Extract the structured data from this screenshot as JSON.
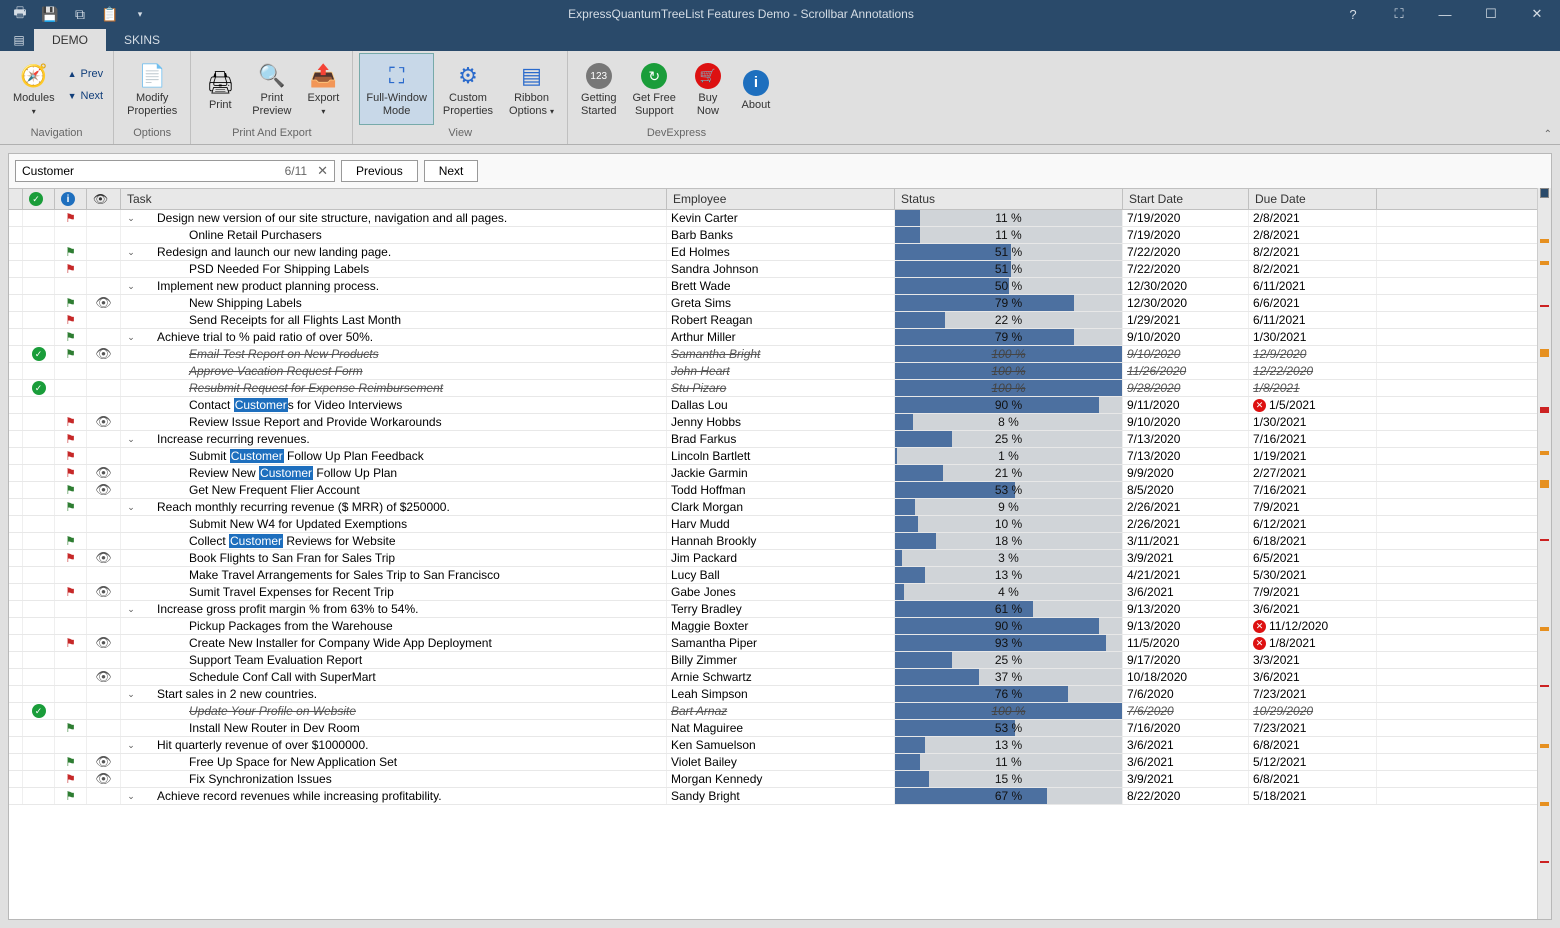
{
  "window": {
    "title": "ExpressQuantumTreeList Features Demo - Scrollbar Annotations"
  },
  "tabs": {
    "demo": "DEMO",
    "skins": "SKINS"
  },
  "ribbon": {
    "modules": "Modules",
    "navigation": "Navigation",
    "prev": "Prev",
    "next": "Next",
    "modify_props": "Modify\nProperties",
    "options": "Options",
    "print": "Print",
    "print_preview": "Print\nPreview",
    "export": "Export",
    "print_and_export": "Print And Export",
    "full_window": "Full-Window\nMode",
    "custom_props": "Custom\nProperties",
    "ribbon_opts": "Ribbon\nOptions",
    "view": "View",
    "getting_started": "Getting\nStarted",
    "get_free_support": "Get Free\nSupport",
    "buy_now": "Buy\nNow",
    "about": "About",
    "devexpress": "DevExpress"
  },
  "search": {
    "value": "Customer",
    "count": "6/11",
    "previous": "Previous",
    "next": "Next"
  },
  "columns": {
    "task": "Task",
    "employee": "Employee",
    "status": "Status",
    "start": "Start Date",
    "due": "Due Date"
  },
  "rows": [
    {
      "lvl": 1,
      "exp": true,
      "task": "Design new version of our site structure, navigation and all pages.",
      "emp": "Kevin Carter",
      "pct": 11,
      "start": "7/19/2020",
      "due": "2/8/2021",
      "flag": "red"
    },
    {
      "lvl": 2,
      "task": "Online Retail Purchasers",
      "emp": "Barb Banks",
      "pct": 11,
      "start": "7/19/2020",
      "due": "2/8/2021"
    },
    {
      "lvl": 1,
      "exp": true,
      "task": "Redesign and launch our new landing page.",
      "emp": "Ed Holmes",
      "pct": 51,
      "start": "7/22/2020",
      "due": "8/2/2021",
      "flag": "green"
    },
    {
      "lvl": 2,
      "task": "PSD Needed For Shipping Labels",
      "emp": "Sandra Johnson",
      "pct": 51,
      "start": "7/22/2020",
      "due": "8/2/2021",
      "flag": "red"
    },
    {
      "lvl": 1,
      "exp": true,
      "task": "Implement new product planning process.",
      "emp": "Brett Wade",
      "pct": 50,
      "start": "12/30/2020",
      "due": "6/11/2021"
    },
    {
      "lvl": 2,
      "task": "New Shipping Labels",
      "emp": "Greta Sims",
      "pct": 79,
      "start": "12/30/2020",
      "due": "6/6/2021",
      "flag": "green",
      "eye": true
    },
    {
      "lvl": 2,
      "task": "Send Receipts for all Flights Last Month",
      "emp": "Robert Reagan",
      "pct": 22,
      "start": "1/29/2021",
      "due": "6/11/2021",
      "flag": "red"
    },
    {
      "lvl": 1,
      "exp": true,
      "task": "Achieve trial to % paid ratio of over 50%.",
      "emp": "Arthur Miller",
      "pct": 79,
      "start": "9/10/2020",
      "due": "1/30/2021",
      "flag": "green"
    },
    {
      "lvl": 2,
      "task": "Email Test Report on New Products",
      "emp": "Samantha Bright",
      "pct": 100,
      "start": "9/10/2020",
      "due": "12/9/2020",
      "done": true,
      "struck": true,
      "flag": "green",
      "eye": true
    },
    {
      "lvl": 2,
      "task": "Approve Vacation Request Form",
      "emp": "John Heart",
      "pct": 100,
      "start": "11/26/2020",
      "due": "12/22/2020",
      "struck": true
    },
    {
      "lvl": 2,
      "task": "Resubmit Request for Expense Reimbursement",
      "emp": "Stu Pizaro",
      "pct": 100,
      "start": "9/28/2020",
      "due": "1/8/2021",
      "done": true,
      "struck": true
    },
    {
      "lvl": 2,
      "task_pre": "Contact ",
      "task_hl": "Customer",
      "task_post": "s for Video Interviews",
      "emp": "Dallas Lou",
      "pct": 90,
      "start": "9/11/2020",
      "due": "1/5/2021",
      "warn": true
    },
    {
      "lvl": 2,
      "task": "Review Issue Report and Provide Workarounds",
      "emp": "Jenny Hobbs",
      "pct": 8,
      "start": "9/10/2020",
      "due": "1/30/2021",
      "flag": "red",
      "eye": true
    },
    {
      "lvl": 1,
      "exp": true,
      "task": "Increase recurring revenues.",
      "emp": "Brad Farkus",
      "pct": 25,
      "start": "7/13/2020",
      "due": "7/16/2021",
      "flag": "red"
    },
    {
      "lvl": 2,
      "task_pre": "Submit ",
      "task_hl": "Customer",
      "task_post": " Follow Up Plan Feedback",
      "emp": "Lincoln Bartlett",
      "pct": 1,
      "start": "7/13/2020",
      "due": "1/19/2021",
      "flag": "red"
    },
    {
      "lvl": 2,
      "task_pre": "Review New ",
      "task_hl": "Customer",
      "task_post": " Follow Up Plan",
      "emp": "Jackie Garmin",
      "pct": 21,
      "start": "9/9/2020",
      "due": "2/27/2021",
      "flag": "red",
      "eye": true
    },
    {
      "lvl": 2,
      "task": "Get New Frequent Flier Account",
      "emp": "Todd Hoffman",
      "pct": 53,
      "start": "8/5/2020",
      "due": "7/16/2021",
      "flag": "green",
      "eye": true
    },
    {
      "lvl": 1,
      "exp": true,
      "task": "Reach monthly recurring revenue ($ MRR) of $250000.",
      "emp": "Clark Morgan",
      "pct": 9,
      "start": "2/26/2021",
      "due": "7/9/2021",
      "flag": "green"
    },
    {
      "lvl": 2,
      "task": "Submit New W4 for Updated Exemptions",
      "emp": "Harv Mudd",
      "pct": 10,
      "start": "2/26/2021",
      "due": "6/12/2021"
    },
    {
      "lvl": 2,
      "task_pre": "Collect ",
      "task_hl": "Customer",
      "task_post": " Reviews for Website",
      "emp": "Hannah Brookly",
      "pct": 18,
      "start": "3/11/2021",
      "due": "6/18/2021",
      "flag": "green"
    },
    {
      "lvl": 2,
      "task": "Book Flights to San Fran for Sales Trip",
      "emp": "Jim Packard",
      "pct": 3,
      "start": "3/9/2021",
      "due": "6/5/2021",
      "flag": "red",
      "eye": true
    },
    {
      "lvl": 2,
      "task": "Make Travel Arrangements for Sales Trip to San Francisco",
      "emp": "Lucy Ball",
      "pct": 13,
      "start": "4/21/2021",
      "due": "5/30/2021"
    },
    {
      "lvl": 2,
      "task": "Sumit Travel Expenses for Recent Trip",
      "emp": "Gabe Jones",
      "pct": 4,
      "start": "3/6/2021",
      "due": "7/9/2021",
      "flag": "red",
      "eye": true
    },
    {
      "lvl": 1,
      "exp": true,
      "task": "Increase gross profit margin % from 63% to 54%.",
      "emp": "Terry Bradley",
      "pct": 61,
      "start": "9/13/2020",
      "due": "3/6/2021"
    },
    {
      "lvl": 2,
      "task": "Pickup Packages from the Warehouse",
      "emp": "Maggie Boxter",
      "pct": 90,
      "start": "9/13/2020",
      "due": "11/12/2020",
      "warn": true
    },
    {
      "lvl": 2,
      "task": "Create New Installer for Company Wide App Deployment",
      "emp": "Samantha Piper",
      "pct": 93,
      "start": "11/5/2020",
      "due": "1/8/2021",
      "flag": "red",
      "eye": true,
      "warn": true
    },
    {
      "lvl": 2,
      "task": "Support Team Evaluation Report",
      "emp": "Billy Zimmer",
      "pct": 25,
      "start": "9/17/2020",
      "due": "3/3/2021"
    },
    {
      "lvl": 2,
      "task": "Schedule Conf Call with SuperMart",
      "emp": "Arnie Schwartz",
      "pct": 37,
      "start": "10/18/2020",
      "due": "3/6/2021",
      "eye": true
    },
    {
      "lvl": 1,
      "exp": true,
      "task": "Start sales in 2 new countries.",
      "emp": "Leah Simpson",
      "pct": 76,
      "start": "7/6/2020",
      "due": "7/23/2021"
    },
    {
      "lvl": 2,
      "task": "Update Your Profile on Website",
      "emp": "Bart Arnaz",
      "pct": 100,
      "start": "7/6/2020",
      "due": "10/29/2020",
      "done": true,
      "struck": true
    },
    {
      "lvl": 2,
      "task": "Install New Router in Dev Room",
      "emp": "Nat Maguiree",
      "pct": 53,
      "start": "7/16/2020",
      "due": "7/23/2021",
      "flag": "green"
    },
    {
      "lvl": 1,
      "exp": true,
      "task": "Hit quarterly revenue of over $1000000.",
      "emp": "Ken Samuelson",
      "pct": 13,
      "start": "3/6/2021",
      "due": "6/8/2021"
    },
    {
      "lvl": 2,
      "task": "Free Up Space for New Application Set",
      "emp": "Violet Bailey",
      "pct": 11,
      "start": "3/6/2021",
      "due": "5/12/2021",
      "flag": "green",
      "eye": true
    },
    {
      "lvl": 2,
      "task": "Fix Synchronization Issues",
      "emp": "Morgan Kennedy",
      "pct": 15,
      "start": "3/9/2021",
      "due": "6/8/2021",
      "flag": "red",
      "eye": true
    },
    {
      "lvl": 1,
      "exp": true,
      "task": "Achieve record revenues while increasing profitability.",
      "emp": "Sandy Bright",
      "pct": 67,
      "start": "8/22/2020",
      "due": "5/18/2021",
      "flag": "green"
    }
  ]
}
